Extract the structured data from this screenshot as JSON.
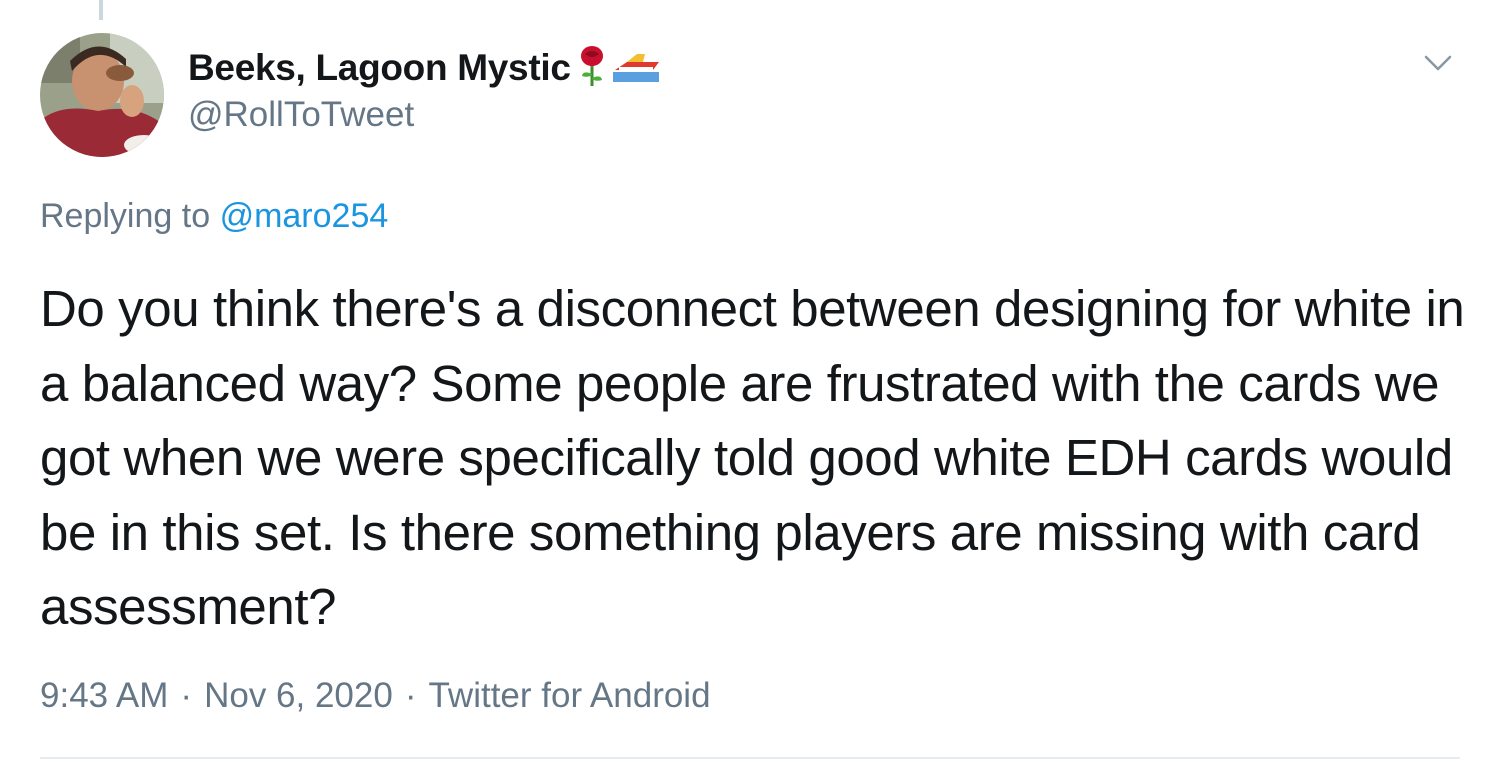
{
  "author": {
    "display_name": "Beeks, Lagoon Mystic",
    "handle": "@RollToTweet",
    "name_emojis": [
      "rose-emoji",
      "speedboat-emoji"
    ]
  },
  "reply_context": {
    "prefix": "Replying to",
    "mention": "@maro254"
  },
  "tweet": {
    "text": "Do you think there's a disconnect between designing for white in a balanced way? Some people are frustrated with the cards we got when we were specifically told good white EDH cards would be in this set. Is there something players are missing with card assessment?"
  },
  "meta": {
    "time": "9:43 AM",
    "separator": "·",
    "date": "Nov 6, 2020",
    "source": "Twitter for Android"
  },
  "icons": {
    "menu": "chevron-down-icon"
  },
  "colors": {
    "text": "#14171a",
    "secondary": "#657786",
    "link": "#1b95e0",
    "divider": "#e6ecf0"
  }
}
